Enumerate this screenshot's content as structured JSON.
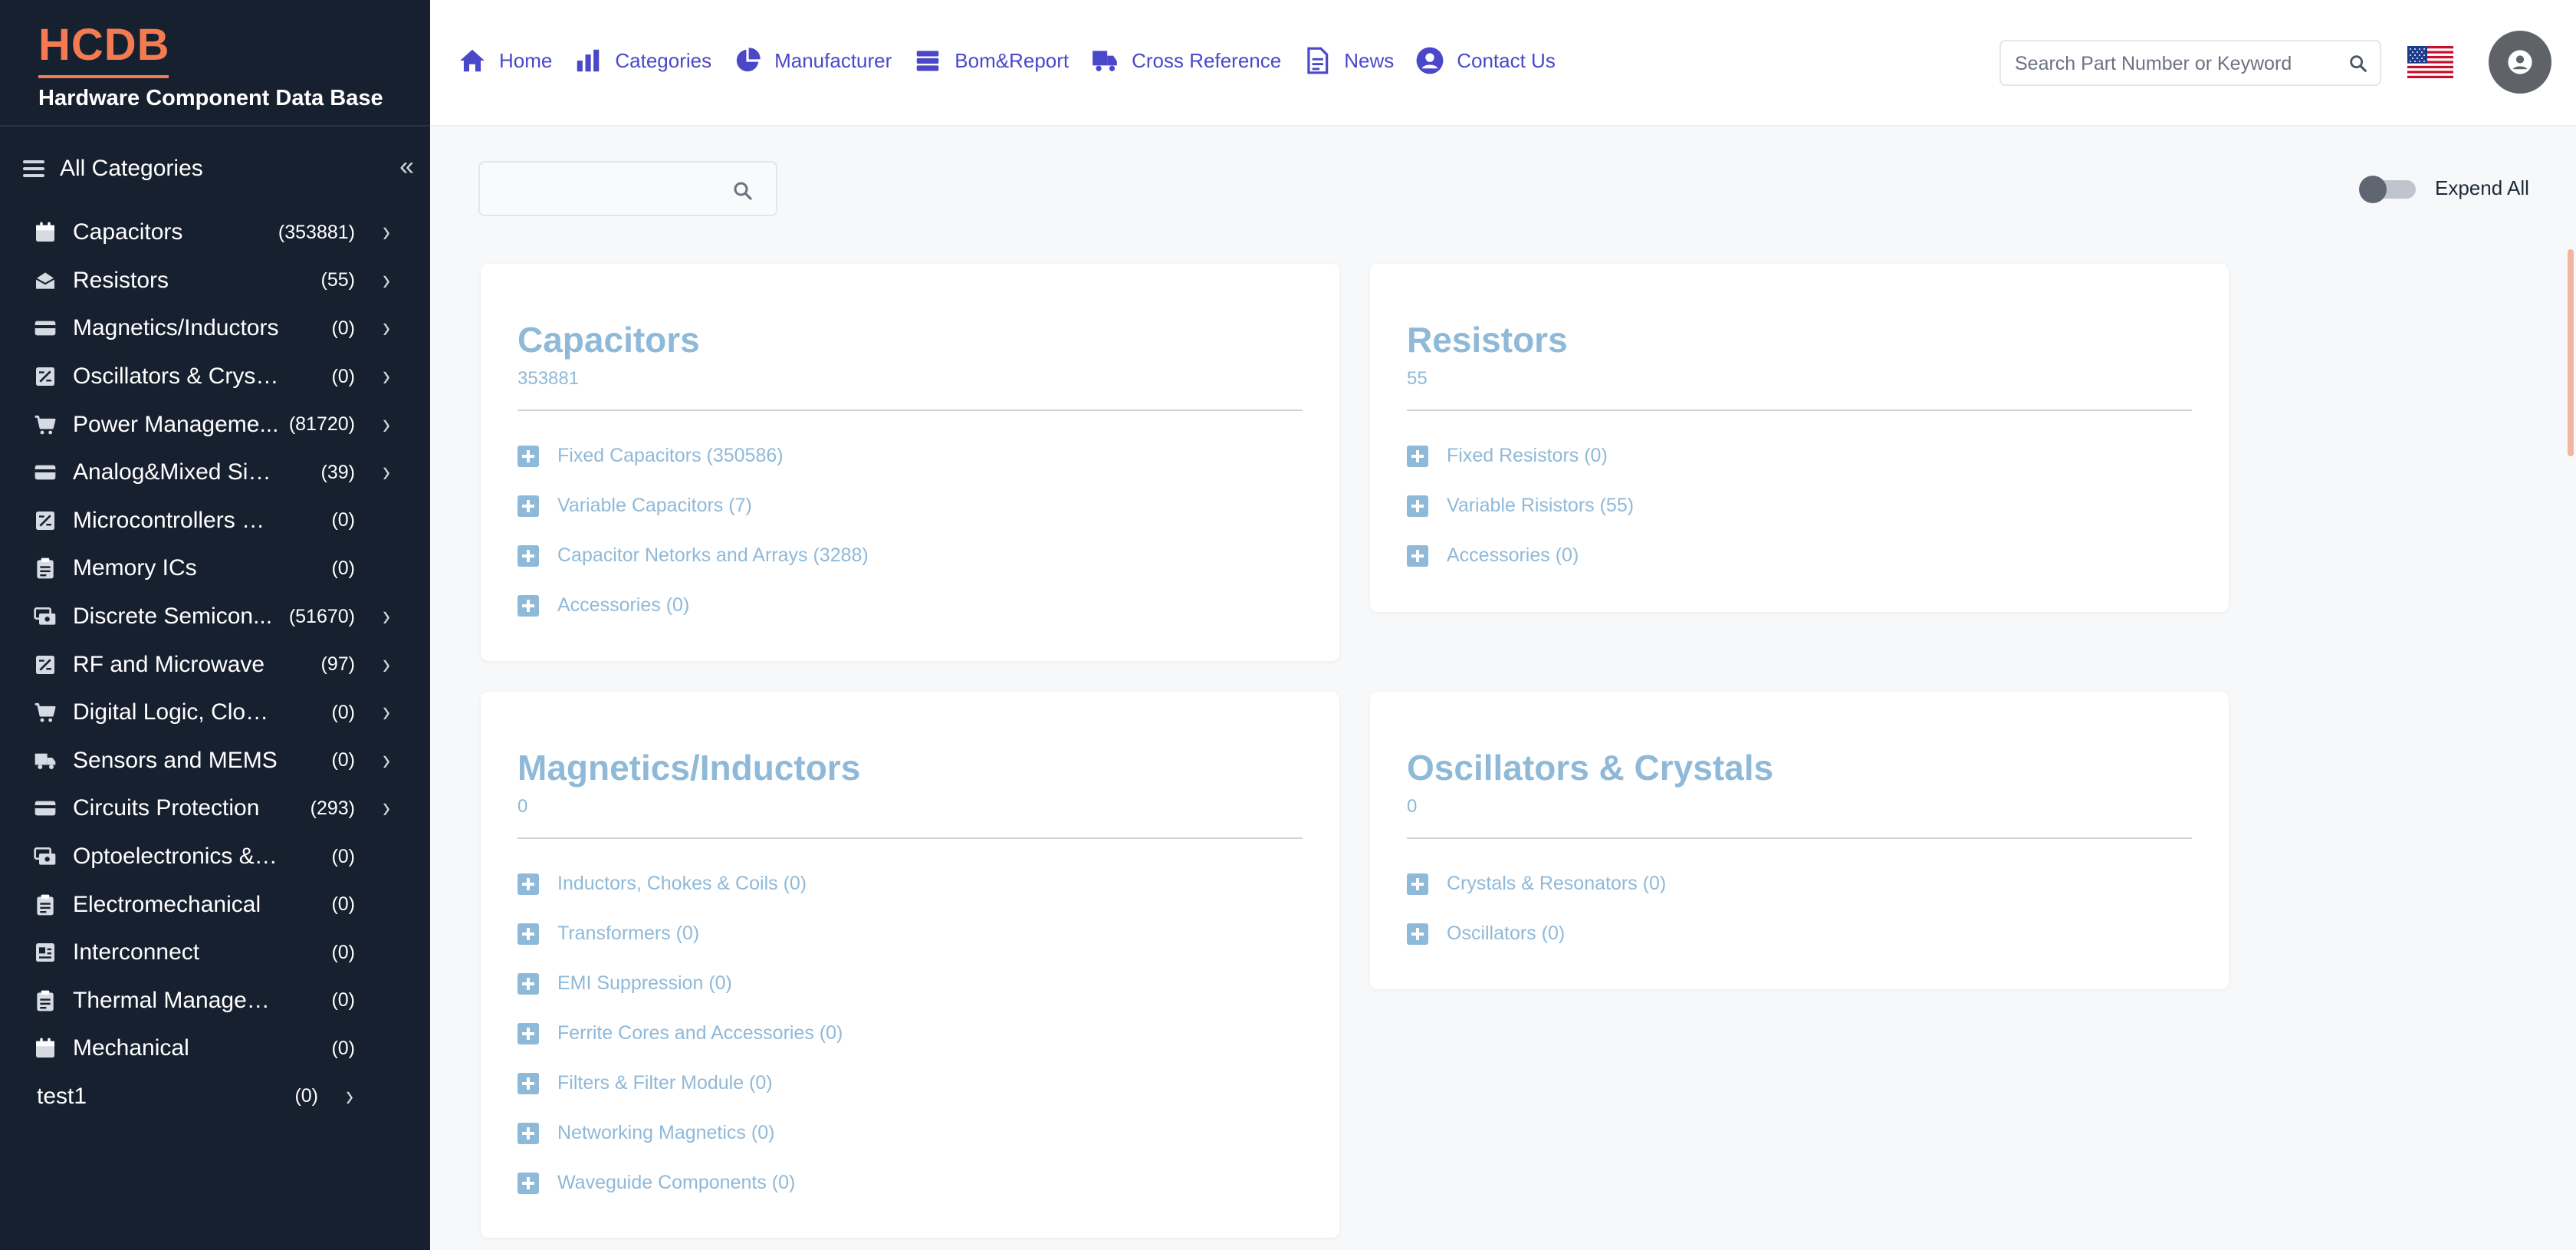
{
  "brand": {
    "logo": "HCDB",
    "subtitle": "Hardware Component Data Base",
    "accent": "#f47a52"
  },
  "sidebar": {
    "header_label": "All Categories",
    "items": [
      {
        "label": "Capacitors",
        "count": "(353881)",
        "icon": "calendar-icon",
        "arrow": true
      },
      {
        "label": "Resistors",
        "count": "(55)",
        "icon": "envelope-open-icon",
        "arrow": true
      },
      {
        "label": "Magnetics/Inductors",
        "count": "(0)",
        "icon": "card-icon",
        "arrow": true
      },
      {
        "label": "Oscillators & Crystals",
        "count": "(0)",
        "icon": "calculator-icon",
        "arrow": true
      },
      {
        "label": "Power Management ICs",
        "display": "Power Manageme...",
        "count": "(81720)",
        "icon": "cart-icon",
        "arrow": true
      },
      {
        "label": "Analog&Mixed Signal ICs",
        "display": "Analog&Mixed Signa...",
        "count": "(39)",
        "icon": "card-icon",
        "arrow": true
      },
      {
        "label": "Microcontrollers & Processors",
        "display": "Microcontrollers & Pr...",
        "count": "(0)",
        "icon": "calculator-icon",
        "arrow": false
      },
      {
        "label": "Memory ICs",
        "count": "(0)",
        "icon": "clipboard-icon",
        "arrow": false
      },
      {
        "label": "Discrete Semiconductors",
        "display": "Discrete Semicon...",
        "count": "(51670)",
        "icon": "cards-icon",
        "arrow": true
      },
      {
        "label": "RF and Microwave",
        "count": "(97)",
        "icon": "calculator-icon",
        "arrow": true
      },
      {
        "label": "Digital Logic, Clock & Timing",
        "display": "Digital Logic, Clock & ...",
        "count": "(0)",
        "icon": "cart-icon",
        "arrow": true
      },
      {
        "label": "Sensors and MEMS",
        "count": "(0)",
        "icon": "truck-icon",
        "arrow": true
      },
      {
        "label": "Circuits Protection",
        "count": "(293)",
        "icon": "card-icon",
        "arrow": true
      },
      {
        "label": "Optoelectronics & LEDs",
        "count": "(0)",
        "icon": "cards-icon",
        "arrow": false
      },
      {
        "label": "Electromechanical",
        "count": "(0)",
        "icon": "clipboard-icon",
        "arrow": false
      },
      {
        "label": "Interconnect",
        "count": "(0)",
        "icon": "id-card-icon",
        "arrow": false
      },
      {
        "label": "Thermal Management",
        "count": "(0)",
        "icon": "clipboard-icon",
        "arrow": false
      },
      {
        "label": "Mechanical",
        "count": "(0)",
        "icon": "calendar-icon",
        "arrow": false
      }
    ],
    "extra_item": {
      "label": "test1",
      "count": "(0)"
    }
  },
  "nav": {
    "items": [
      {
        "label": "Home",
        "icon": "home-icon"
      },
      {
        "label": "Categories",
        "icon": "bar-chart-icon"
      },
      {
        "label": "Manufacturer",
        "icon": "pie-chart-icon"
      },
      {
        "label": "Bom&Report",
        "icon": "stack-icon"
      },
      {
        "label": "Cross Reference",
        "icon": "truck-icon"
      },
      {
        "label": "News",
        "icon": "document-icon"
      },
      {
        "label": "Contact Us",
        "icon": "user-circle-icon"
      }
    ],
    "color": "#4a47c9"
  },
  "search": {
    "placeholder": "Search Part Number or Keyword",
    "value": ""
  },
  "filter": {
    "placeholder": "",
    "value": ""
  },
  "toggle": {
    "label": "Expend All",
    "on": false
  },
  "cards": [
    {
      "title": "Capacitors",
      "count": "353881",
      "items": [
        "Fixed Capacitors (350586)",
        "Variable Capacitors (7)",
        "Capacitor Netorks and Arrays (3288)",
        "Accessories (0)"
      ]
    },
    {
      "title": "Resistors",
      "count": "55",
      "items": [
        "Fixed Resistors (0)",
        "Variable Risistors (55)",
        "Accessories (0)"
      ]
    },
    {
      "title": "Magnetics/Inductors",
      "count": "0",
      "items": [
        "Inductors, Chokes & Coils (0)",
        "Transformers (0)",
        "EMI Suppression (0)",
        "Ferrite Cores and Accessories (0)",
        "Filters & Filter Module (0)",
        "Networking Magnetics (0)",
        "Waveguide Components (0)"
      ]
    },
    {
      "title": "Oscillators & Crystals",
      "count": "0",
      "items": [
        "Crystals & Resonators (0)",
        "Oscillators (0)"
      ]
    }
  ],
  "card_color": "#8fb9d8"
}
